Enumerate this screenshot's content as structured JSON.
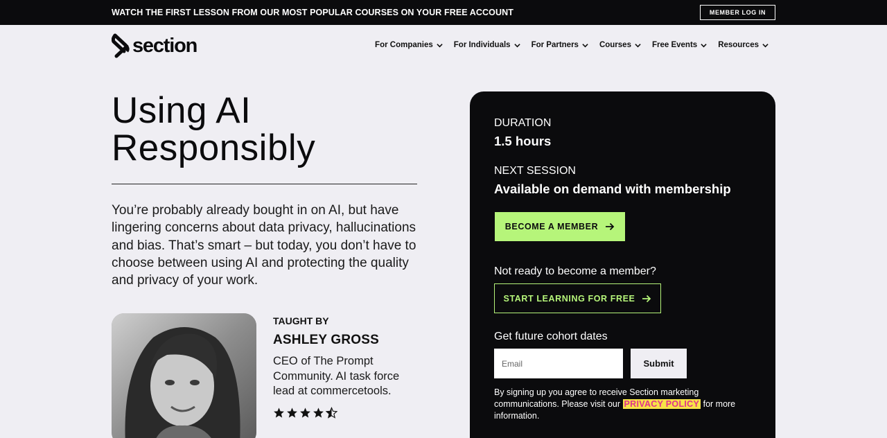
{
  "announcement": {
    "text": "WATCH THE FIRST LESSON FROM OUR MOST POPULAR COURSES ON YOUR FREE ACCOUNT",
    "login_label": "MEMBER LOG IN"
  },
  "brand": {
    "name": "section",
    "logo_icon": "section-s-logo-icon"
  },
  "nav": {
    "items": [
      {
        "label": "For Companies"
      },
      {
        "label": "For Individuals"
      },
      {
        "label": "For Partners"
      },
      {
        "label": "Courses"
      },
      {
        "label": "Free Events"
      },
      {
        "label": "Resources"
      }
    ]
  },
  "course": {
    "title_line1": "Using AI",
    "title_line2": "Responsibly",
    "description": "You’re probably already bought in on AI, but have lingering concerns about data privacy, hallucinations and bias. That’s smart – but today, you don’t have to choose between using AI and protecting the quality and privacy of your work."
  },
  "instructor": {
    "heading": "TAUGHT BY",
    "name": "ASHLEY GROSS",
    "bio": "CEO of The Prompt Community. AI task force lead at commercetools.",
    "rating": 4.5,
    "rating_max": 5
  },
  "card": {
    "duration_label": "DURATION",
    "duration_value": "1.5 hours",
    "next_label": "NEXT SESSION",
    "next_value": "Available on demand with membership",
    "become_label": "BECOME A MEMBER",
    "not_ready_text": "Not ready to become a member?",
    "start_label": "START LEARNING FOR FREE",
    "cohort_label": "Get future cohort dates",
    "email_placeholder": "Email",
    "submit_label": "Submit",
    "legal_before": "By signing up you agree to receive Section marketing communications. Please visit our ",
    "privacy_label": "PRIVACY POLICY",
    "legal_after": " for more information."
  },
  "colors": {
    "accent_green": "#b6f57a",
    "dark": "#0b0b0d",
    "page_bg": "#efeef3",
    "highlight_yellow": "#f7e348",
    "privacy_pink": "#e0338a"
  }
}
